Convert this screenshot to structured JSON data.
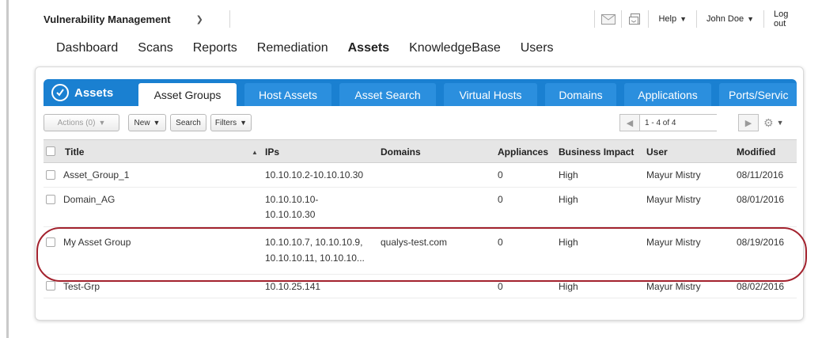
{
  "topbar": {
    "app_name": "Vulnerability Management",
    "help": "Help",
    "user": "John Doe",
    "logout": "Log out",
    "icons": [
      "mail-icon",
      "inbox-icon"
    ]
  },
  "nav": {
    "items": [
      "Dashboard",
      "Scans",
      "Reports",
      "Remediation",
      "Assets",
      "KnowledgeBase",
      "Users"
    ],
    "active": "Assets"
  },
  "tabs": {
    "brand": "Assets",
    "items": [
      "Asset Groups",
      "Host Assets",
      "Asset Search",
      "Virtual Hosts",
      "Domains",
      "Applications",
      "Ports/Servic"
    ],
    "active": "Asset Groups"
  },
  "toolbar": {
    "actions": "Actions (0)",
    "new": "New",
    "search": "Search",
    "filters": "Filters",
    "pager_text": "1 - 4 of 4"
  },
  "table": {
    "columns": [
      "Title",
      "IPs",
      "Domains",
      "Appliances",
      "Business Impact",
      "User",
      "Modified"
    ],
    "rows": [
      {
        "title": "Asset_Group_1",
        "ips1": "10.10.10.2-10.10.10.30",
        "ips2": "",
        "domains": "",
        "appliances": "0",
        "impact": "High",
        "user": "Mayur Mistry",
        "modified": "08/11/2016"
      },
      {
        "title": "Domain_AG",
        "ips1": "10.10.10.10-",
        "ips2": "10.10.10.30",
        "domains": "",
        "appliances": "0",
        "impact": "High",
        "user": "Mayur Mistry",
        "modified": "08/01/2016"
      },
      {
        "title": "My Asset Group",
        "ips1": "10.10.10.7, 10.10.10.9,",
        "ips2": "10.10.10.11, 10.10.10...",
        "domains": "qualys-test.com",
        "appliances": "0",
        "impact": "High",
        "user": "Mayur Mistry",
        "modified": "08/19/2016"
      },
      {
        "title": "Test-Grp",
        "ips1": "10.10.25.141",
        "ips2": "",
        "domains": "",
        "appliances": "0",
        "impact": "High",
        "user": "Mayur Mistry",
        "modified": "08/02/2016"
      }
    ]
  },
  "colors": {
    "tab_blue": "#1a80d1",
    "highlight": "#a3222e"
  }
}
